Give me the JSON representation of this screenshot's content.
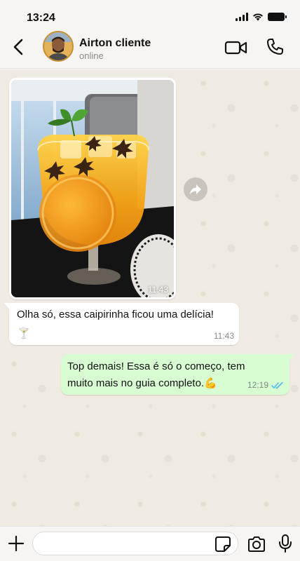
{
  "status_bar": {
    "time": "13:24",
    "icons": [
      "signal-icon",
      "wifi-icon",
      "battery-icon"
    ]
  },
  "header": {
    "back_icon": "chevron-left-icon",
    "contact_name": "Airton cliente",
    "contact_status": "online",
    "video_call_icon": "video-camera-icon",
    "voice_call_icon": "phone-icon"
  },
  "messages": [
    {
      "type": "image",
      "direction": "incoming",
      "image_subject": "orange caipirinha cocktail with mint and star anise",
      "time": "11:43"
    },
    {
      "type": "text",
      "direction": "incoming",
      "text": "Olha só, essa caipirinha ficou uma delícia!",
      "emoji": "🍸",
      "time": "11:43"
    },
    {
      "type": "text",
      "direction": "outgoing",
      "line1": "Top demais! Essa é só o começo, tem",
      "line2": "muito mais no guia completo.💪",
      "time": "12:19",
      "status_icon": "double-check-read-icon"
    }
  ],
  "composer": {
    "value": "",
    "plus_icon": "plus-icon",
    "sticker_icon": "sticker-icon",
    "camera_icon": "camera-icon",
    "mic_icon": "microphone-icon"
  },
  "colors": {
    "accent_blue": "#53bdeb",
    "outgoing_bubble": "#d9fdd3",
    "incoming_bubble": "#ffffff",
    "chat_background": "#efeae2"
  }
}
